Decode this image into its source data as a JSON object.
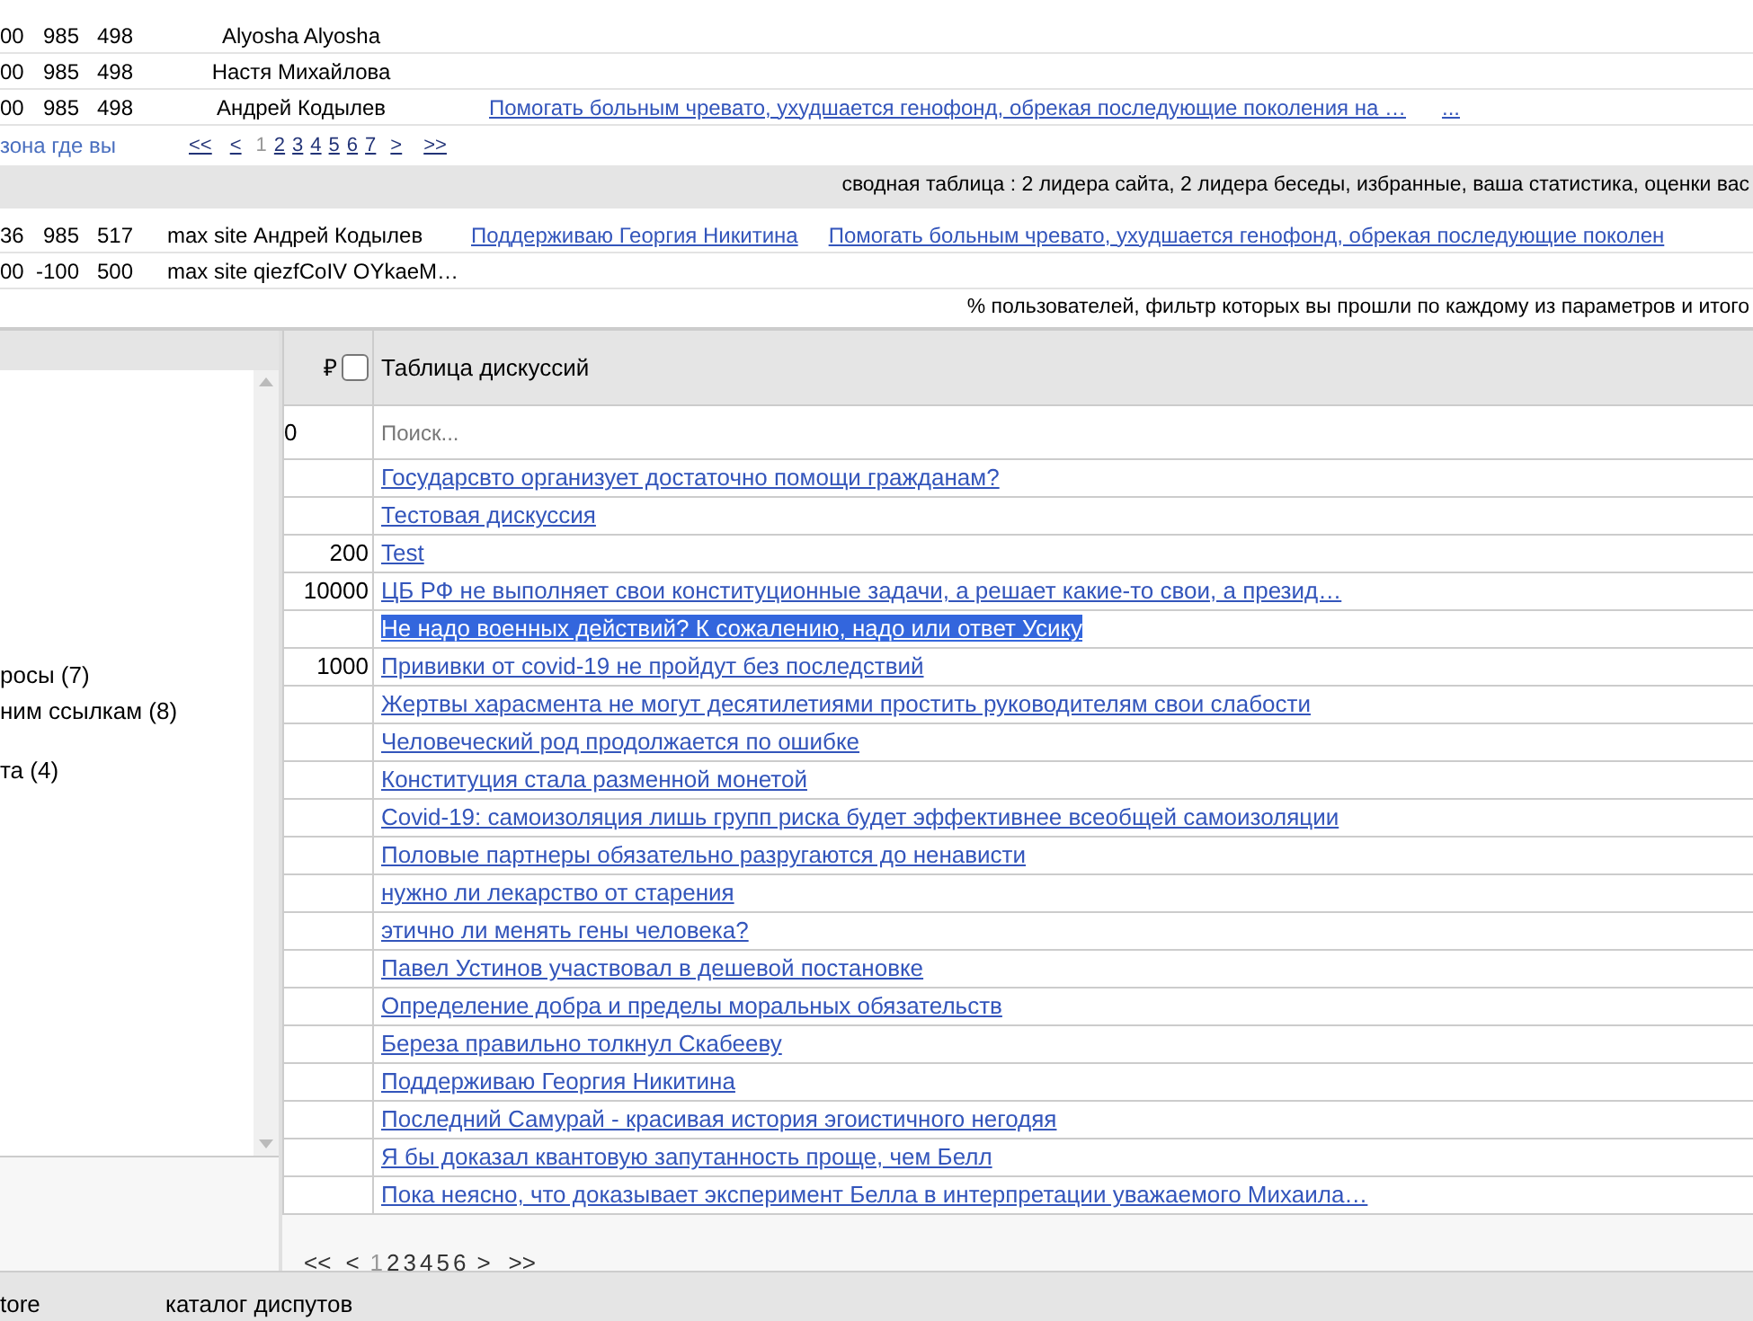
{
  "top_rows": [
    {
      "c1": "00",
      "c2": "985",
      "c3": "498",
      "name": "Alyosha Alyosha"
    },
    {
      "c1": "00",
      "c2": "985",
      "c3": "498",
      "name": "Настя Михайлова"
    },
    {
      "c1": "00",
      "c2": "985",
      "c3": "498",
      "name": "Андрей Кодылев",
      "link": "Помогать больным чревато, ухудшается генофонд, обрекая последующие поколения на …",
      "more": "..."
    }
  ],
  "zone_label": "зона где вы",
  "top_pager": {
    "first": "<<",
    "prev": "<",
    "pages": [
      {
        "label": "1",
        "selected": true
      },
      {
        "label": "2",
        "selected": false
      },
      {
        "label": "3",
        "selected": false
      },
      {
        "label": "4",
        "selected": false
      },
      {
        "label": "5",
        "selected": false
      },
      {
        "label": "6",
        "selected": false
      },
      {
        "label": "7",
        "selected": false
      }
    ],
    "next": ">",
    "last": ">>"
  },
  "summary_bar": "сводная таблица : 2 лидера сайта, 2 лидера беседы, избранные, ваша статистика, оценки вас",
  "leaders": [
    {
      "c1": "36",
      "c2": "985",
      "c3": "517",
      "name": "max site Андрей Кодылев",
      "links": [
        "Поддерживаю Георгия Никитина",
        "Помогать больным чревато, ухудшается генофонд, обрекая последующие поколен"
      ]
    },
    {
      "c1": "00",
      "c2": "-100",
      "c3": "500",
      "name": "max site qiezfCoIV OYkaeM…"
    }
  ],
  "filter_caption": "% пользователей, фильтр которых вы прошли по каждому из параметров и итого",
  "left_list": [
    "росы (7)",
    "ним ссылкам (8)",
    "та (4)"
  ],
  "table": {
    "currency": "₽",
    "filter_checked": false,
    "title": "Таблица дискуссий",
    "search_value": "0",
    "search_placeholder": "Поиск...",
    "rows": [
      {
        "amount": "",
        "title": "Государсвто организует достаточно помощи гражданам?",
        "selected": false
      },
      {
        "amount": "",
        "title": "Тестовая дискуссия",
        "selected": false
      },
      {
        "amount": "200",
        "title": "Test",
        "selected": false
      },
      {
        "amount": "10000",
        "title": "ЦБ РФ не выполняет свои конституционные задачи, а решает какие-то свои, а презид…",
        "selected": false
      },
      {
        "amount": "",
        "title": "Не надо военных действий? К сожалению, надо или ответ Усику",
        "selected": true
      },
      {
        "amount": "1000",
        "title": "Прививки от covid-19 не пройдут без последствий",
        "selected": false
      },
      {
        "amount": "",
        "title": "Жертвы харасмента не могут десятилетиями простить руководителям свои слабости",
        "selected": false
      },
      {
        "amount": "",
        "title": "Человеческий род продолжается по ошибке",
        "selected": false
      },
      {
        "amount": "",
        "title": "Конституция стала разменной монетой",
        "selected": false
      },
      {
        "amount": "",
        "title": "Covid-19: самоизоляция лишь групп риска будет эффективнее всеобщей самоизоляции",
        "selected": false
      },
      {
        "amount": "",
        "title": "Половые партнеры обязательно разругаются до ненависти",
        "selected": false
      },
      {
        "amount": "",
        "title": "нужно ли лекарство от старения",
        "selected": false
      },
      {
        "amount": "",
        "title": "этично ли менять гены человека?",
        "selected": false
      },
      {
        "amount": "",
        "title": "Павел Устинов участвовал в дешевой постановке",
        "selected": false
      },
      {
        "amount": "",
        "title": "Определение добра и пределы моральных обязательств",
        "selected": false
      },
      {
        "amount": "",
        "title": "Береза правильно толкнул Скабееву",
        "selected": false
      },
      {
        "amount": "",
        "title": "Поддерживаю Георгия Никитина",
        "selected": false
      },
      {
        "amount": "",
        "title": "Последний Самурай - красивая история эгоистичного негодяя",
        "selected": false
      },
      {
        "amount": "",
        "title": "Я бы доказал квантовую запутанность проще, чем Белл",
        "selected": false
      },
      {
        "amount": "",
        "title": "Пока неясно, что доказывает эксперимент Белла в интерпретации уважаемого Михаила…",
        "selected": false
      }
    ]
  },
  "bottom_pager": {
    "first": "<<",
    "prev": "<",
    "pages": [
      {
        "label": "1",
        "selected": true
      },
      {
        "label": "2",
        "selected": false
      },
      {
        "label": "3",
        "selected": false
      },
      {
        "label": "4",
        "selected": false
      },
      {
        "label": "5",
        "selected": false
      },
      {
        "label": "6",
        "selected": false
      }
    ],
    "next": ">",
    "last": ">>"
  },
  "footer": [
    "tore",
    "каталог диспутов"
  ]
}
